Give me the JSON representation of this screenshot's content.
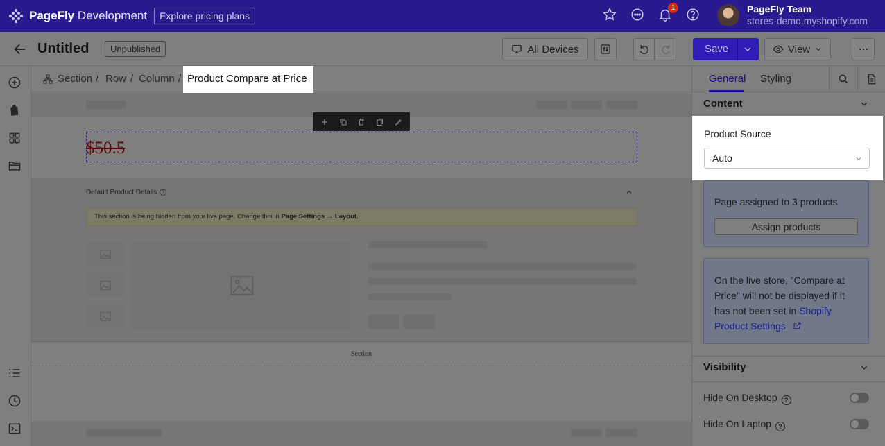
{
  "app": {
    "brand_bold": "PageFly",
    "brand_rest": " Development",
    "pricing_label": "Explore pricing plans",
    "notification_count": "1",
    "user_name": "PageFly Team",
    "user_store": "stores-demo.myshopify.com"
  },
  "editor": {
    "title": "Untitled",
    "status": "Unpublished",
    "device_label": "All Devices",
    "save_label": "Save",
    "view_label": "View"
  },
  "breadcrumb": {
    "items": [
      "Section",
      "Row",
      "Column"
    ],
    "separator": "/",
    "current": "Product Compare at Price"
  },
  "canvas": {
    "price": "$50.5",
    "details_title": "Default Product Details",
    "notice_text": "This section is being hidden from your live page. Change this in ",
    "notice_bold": "Page Settings → Layout.",
    "section_label": "Section"
  },
  "panel": {
    "tabs": [
      "General",
      "Styling"
    ],
    "content_heading": "Content",
    "product_source_label": "Product Source",
    "product_source_value": "Auto",
    "assigned_text": "Page assigned to 3 products",
    "assign_button": "Assign products",
    "live_text": "On the live store, \"Compare at Price\" will not be displayed if it has not been set in ",
    "live_link": "Shopify Product Settings",
    "visibility_heading": "Visibility",
    "hide_desktop": "Hide On Desktop",
    "hide_laptop": "Hide On Laptop"
  },
  "colors": {
    "brand_bar": "#2a1a8f",
    "accent": "#1c0f86",
    "save_button": "#2f1cb8"
  }
}
